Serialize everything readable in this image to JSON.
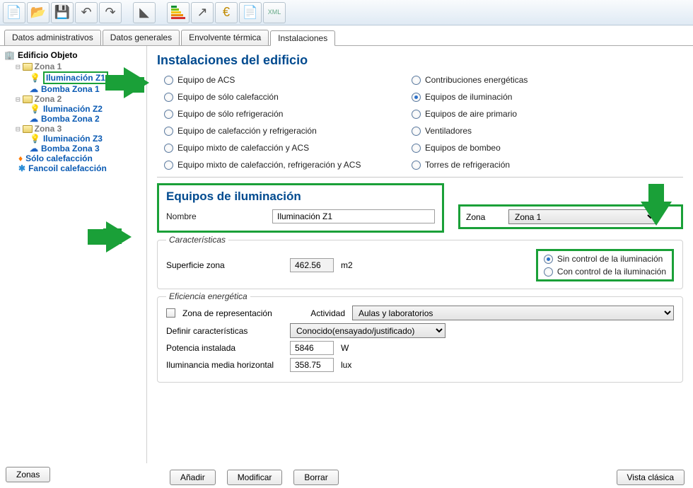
{
  "tabs": [
    "Datos administrativos",
    "Datos generales",
    "Envolvente térmica",
    "Instalaciones"
  ],
  "active_tab": 3,
  "tree": {
    "root": "Edificio Objeto",
    "zones": [
      {
        "name": "Zona 1",
        "items": [
          {
            "label": "Iluminación Z1",
            "icon": "bulb",
            "selected": true
          },
          {
            "label": "Bomba Zona 1",
            "icon": "pump"
          }
        ]
      },
      {
        "name": "Zona 2",
        "items": [
          {
            "label": "Iluminación Z2",
            "icon": "bulb"
          },
          {
            "label": "Bomba Zona 2",
            "icon": "pump"
          }
        ]
      },
      {
        "name": "Zona 3",
        "items": [
          {
            "label": "Iluminación Z3",
            "icon": "bulb"
          },
          {
            "label": "Bomba Zona 3",
            "icon": "pump"
          }
        ]
      }
    ],
    "extras": [
      {
        "label": "Sólo calefacción",
        "icon": "flame"
      },
      {
        "label": "Fancoil calefacción",
        "icon": "fan"
      }
    ]
  },
  "zones_btn": "Zonas",
  "content": {
    "title": "Instalaciones del edificio",
    "options_left": [
      "Equipo de ACS",
      "Equipo de sólo calefacción",
      "Equipo de sólo refrigeración",
      "Equipo de calefacción y refrigeración",
      "Equipo mixto de calefacción y ACS",
      "Equipo mixto de calefacción, refrigeración y ACS"
    ],
    "options_right": [
      "Contribuciones energéticas",
      "Equipos de iluminación",
      "Equipos de aire primario",
      "Ventiladores",
      "Equipos de bombeo",
      "Torres de refrigeración"
    ],
    "selected_option": "Equipos de iluminación",
    "panel_title": "Equipos de iluminación",
    "name_label": "Nombre",
    "name_value": "Iluminación Z1",
    "zone_label": "Zona",
    "zone_value": "Zona 1",
    "caract_legend": "Características",
    "surf_label": "Superficie zona",
    "surf_value": "462.56",
    "surf_unit": "m2",
    "ctrl_options": [
      "Sin control de la iluminación",
      "Con control de la iluminación"
    ],
    "ctrl_selected": 0,
    "eff_legend": "Eficiencia energética",
    "rep_label": "Zona de representación",
    "act_label": "Actividad",
    "act_value": "Aulas y laboratorios",
    "def_label": "Definir características",
    "def_value": "Conocido(ensayado/justificado)",
    "pot_label": "Potencia instalada",
    "pot_value": "5846",
    "pot_unit": "W",
    "ilum_label": "Iluminancia media horizontal",
    "ilum_value": "358.75",
    "ilum_unit": "lux"
  },
  "footer": {
    "add": "Añadir",
    "modify": "Modificar",
    "delete": "Borrar",
    "classic": "Vista clásica"
  }
}
